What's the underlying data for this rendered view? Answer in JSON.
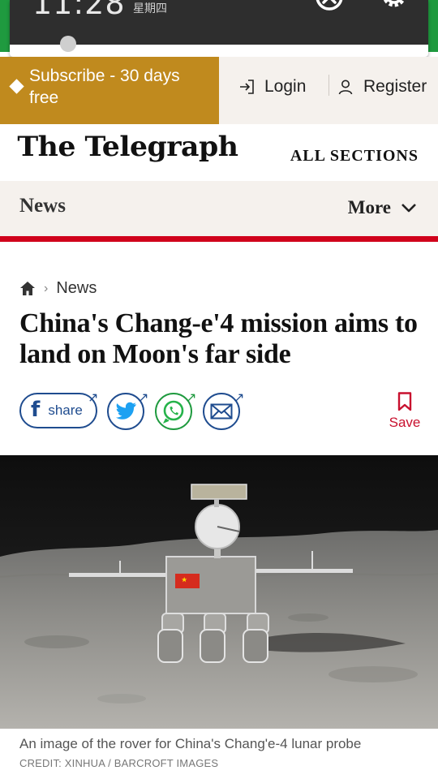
{
  "notification": {
    "time": "11:28",
    "day": "星期四"
  },
  "topbar": {
    "subscribe_label": "Subscribe - 30 days free",
    "login_label": "Login",
    "register_label": "Register"
  },
  "masthead": {
    "logo": "The Telegraph",
    "all_sections_label": "ALL SECTIONS"
  },
  "section_nav": {
    "title": "News",
    "more_label": "More"
  },
  "article": {
    "breadcrumb": [
      "News"
    ],
    "headline": "China's Chang-e'4 mission aims to land on Moon's far side",
    "share_label": "share",
    "save_label": "Save",
    "caption": "An image of the rover for China's Chang'e-4 lunar probe",
    "credit": "CREDIT: XINHUA / BARCROFT IMAGES"
  },
  "colors": {
    "subscribe_bg": "#c08a1e",
    "account_bg": "#f5f1ed",
    "accent_red": "#d0021b",
    "facebook": "#1f4c8f",
    "twitter": "#1da1f2",
    "whatsapp": "#25b34a",
    "email": "#1f4c8f",
    "save": "#c8102e"
  },
  "icons": {
    "close": "close-circle-icon",
    "gear": "gear-icon",
    "login": "login-arrow-icon",
    "register": "user-icon",
    "more": "chevron-down-icon",
    "home": "home-icon",
    "facebook": "facebook-icon",
    "twitter": "twitter-icon",
    "whatsapp": "whatsapp-icon",
    "email": "email-icon",
    "save": "bookmark-icon"
  }
}
